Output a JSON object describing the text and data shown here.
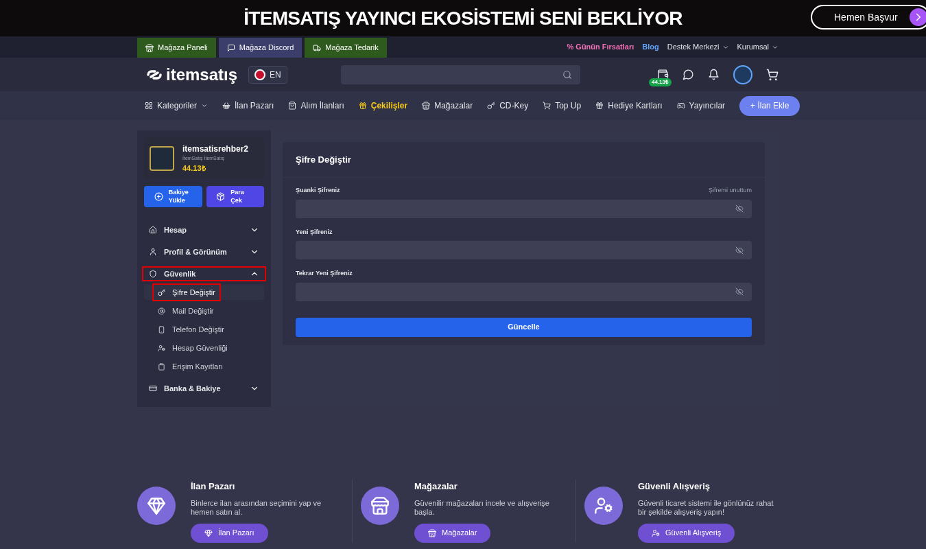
{
  "banner": {
    "title": "İTEMSATIŞ YAYINCI EKOSİSTEMİ SENİ BEKLİYOR",
    "button": "Hemen Başvur"
  },
  "top_bar": {
    "store_tabs": [
      {
        "label": "Mağaza Paneli",
        "color": "#2f5a1e"
      },
      {
        "label": "Mağaza Discord",
        "color": "#3b3d6b"
      },
      {
        "label": "Mağaza Tedarik",
        "color": "#2f5a1e"
      }
    ],
    "links": [
      {
        "label": "% Günün Fırsatları",
        "kind": "deal"
      },
      {
        "label": "Blog",
        "kind": "blog"
      },
      {
        "label": "Destek Merkezi",
        "kind": "menu"
      },
      {
        "label": "Kurumsal",
        "kind": "menu"
      }
    ]
  },
  "header": {
    "logo": "itemsatış",
    "language": "EN",
    "wallet_balance": "44.13₺"
  },
  "nav": {
    "items": [
      {
        "label": "Kategoriler",
        "selected": false,
        "dropdown": true
      },
      {
        "label": "İlan Pazarı",
        "selected": false,
        "dropdown": false
      },
      {
        "label": "Alım İlanları",
        "selected": false,
        "dropdown": false
      },
      {
        "label": "Çekilişler",
        "selected": true,
        "dropdown": false
      },
      {
        "label": "Mağazalar",
        "selected": false,
        "dropdown": false
      },
      {
        "label": "CD-Key",
        "selected": false,
        "dropdown": false
      },
      {
        "label": "Top Up",
        "selected": false,
        "dropdown": false
      },
      {
        "label": "Hediye Kartları",
        "selected": false,
        "dropdown": false
      },
      {
        "label": "Yayıncılar",
        "selected": false,
        "dropdown": false
      }
    ],
    "add_button": "+ İlan Ekle"
  },
  "sidebar": {
    "user": {
      "name": "itemsatisrehber2",
      "subtitle": "İtemSatış İtemSatış",
      "balance": "44.13₺"
    },
    "actions": [
      "Bakiye Yükle",
      "Para Çek"
    ],
    "sections": [
      {
        "label": "Hesap",
        "expanded": false,
        "highlighted": false
      },
      {
        "label": "Profil & Görünüm",
        "expanded": false,
        "highlighted": false
      },
      {
        "label": "Güvenlik",
        "expanded": true,
        "highlighted": true,
        "children": [
          {
            "label": "Şifre Değiştir",
            "selected": true,
            "highlighted": true
          },
          {
            "label": "Mail Değiştir",
            "selected": false,
            "highlighted": false
          },
          {
            "label": "Telefon Değiştir",
            "selected": false,
            "highlighted": false
          },
          {
            "label": "Hesap Güvenliği",
            "selected": false,
            "highlighted": false
          },
          {
            "label": "Erişim Kayıtları",
            "selected": false,
            "highlighted": false
          }
        ]
      },
      {
        "label": "Banka & Bakiye",
        "expanded": false,
        "highlighted": false
      }
    ]
  },
  "form": {
    "title": "Şifre Değiştir",
    "forgot_link": "Şifremi unuttum",
    "fields": [
      {
        "label": "Şuanki Şifreniz"
      },
      {
        "label": "Yeni Şifreniz"
      },
      {
        "label": "Tekrar Yeni Şifreniz"
      }
    ],
    "submit": "Güncelle"
  },
  "features": [
    {
      "title": "İlan Pazarı",
      "text": "Binlerce ilan arasından seçimini yap ve hemen satın al.",
      "button": "İlan Pazarı"
    },
    {
      "title": "Mağazalar",
      "text": "Güvenilir mağazaları incele ve alışverişe başla.",
      "button": "Mağazalar"
    },
    {
      "title": "Güvenli Alışveriş",
      "text": "Güvenli ticaret sistemi ile gönlünüz rahat bir şekilde alışveriş yapın!",
      "button": "Güvenli Alışveriş"
    }
  ]
}
